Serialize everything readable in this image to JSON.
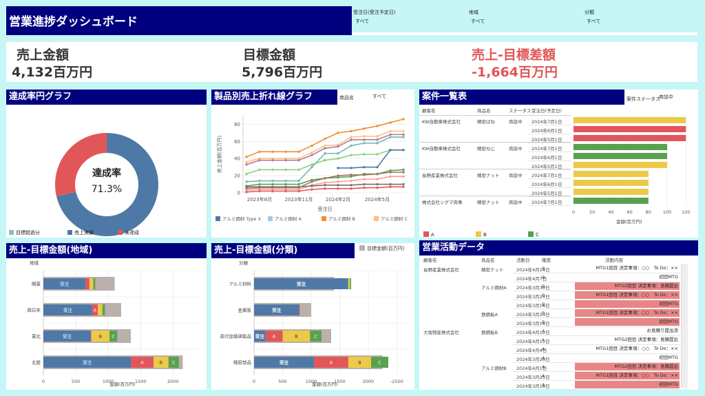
{
  "header": {
    "title": "営業進捗ダッシュボード",
    "filters": [
      {
        "label": "受注日(受注予定日)",
        "value": "すべて"
      },
      {
        "label": "地域",
        "value": "すべて"
      },
      {
        "label": "分類",
        "value": "すべて"
      }
    ]
  },
  "kpis": [
    {
      "label": "売上金額",
      "value": "4,132百万円",
      "color": "#333333"
    },
    {
      "label": "目標金額",
      "value": "5,796百万円",
      "color": "#333333"
    },
    {
      "label": "売上-目標差額",
      "value": "-1,664百万円",
      "color": "#e05555"
    }
  ],
  "donut": {
    "title": "達成率円グラフ",
    "center_label": "達成率",
    "center_value": "71.3%",
    "legend": [
      "目標超過分",
      "売上実績",
      "未達成"
    ],
    "colors": {
      "over": "#7fc4b8",
      "actual": "#4e79a7",
      "missing": "#e15759"
    }
  },
  "line_panel": {
    "title": "製品別売上折れ線グラフ",
    "filter_label": "商品名",
    "filter_value": "すべて"
  },
  "cases_panel": {
    "title": "案件一覧表",
    "filter_label": "案件ステータス",
    "filter_value": "商談中",
    "columns": [
      "顧客名",
      "商品名",
      "ステータス",
      "受注日(予定日)"
    ],
    "rows": [
      {
        "customer": "KW自動車株式会社",
        "product": "精密ばね",
        "status": "商談中",
        "date": "2024年7月1日"
      },
      {
        "customer": "",
        "product": "",
        "status": "",
        "date": "2024年6月1日"
      },
      {
        "customer": "",
        "product": "",
        "status": "",
        "date": "2024年5月1日"
      },
      {
        "customer": "KW自動車株式会社",
        "product": "精密ねじ",
        "status": "商談中",
        "date": "2024年7月1日"
      },
      {
        "customer": "",
        "product": "",
        "status": "",
        "date": "2024年6月1日"
      },
      {
        "customer": "",
        "product": "",
        "status": "",
        "date": "2024年5月1日"
      },
      {
        "customer": "長野産業株式会社",
        "product": "精密ナット",
        "status": "商談中",
        "date": "2024年7月1日"
      },
      {
        "customer": "",
        "product": "",
        "status": "",
        "date": "2024年6月1日"
      },
      {
        "customer": "",
        "product": "",
        "status": "",
        "date": "2024年5月1日"
      },
      {
        "customer": "株式会社シグマ商事",
        "product": "精密ナット",
        "status": "商談中",
        "date": "2024年7月1日"
      }
    ],
    "xlabel": "金額(百万円)",
    "legend": [
      "A",
      "B",
      "C"
    ]
  },
  "activity_panel": {
    "title": "営業活動データ",
    "columns": [
      "顧客名",
      "商品名",
      "活動日",
      "確度",
      "活動内容"
    ],
    "rows": [
      {
        "customer": "長野産業株式会社",
        "product": "精密ナット",
        "date": "2024年4月14日",
        "rank": "B",
        "content": "MTG1回目 決定事項：○○　To Do：××",
        "hl": false
      },
      {
        "customer": "",
        "product": "",
        "date": "2024年4月7日",
        "rank": "B",
        "content": "初回MTG",
        "hl": false
      },
      {
        "customer": "",
        "product": "アルミ鋼材A",
        "date": "2024年3月30日",
        "rank": "B",
        "content": "MTG2回目 決定事項：見積提出",
        "hl": true
      },
      {
        "customer": "",
        "product": "",
        "date": "2024年3月23日",
        "rank": "B",
        "content": "MTG1回目 決定事項：○○　To Do：××",
        "hl": true
      },
      {
        "customer": "",
        "product": "",
        "date": "2024年3月16日",
        "rank": "B",
        "content": "初回MTG",
        "hl": true
      },
      {
        "customer": "",
        "product": "鉄鋼板A",
        "date": "2024年3月23日",
        "rank": "B",
        "content": "MTG1回目 決定事項：○○　To Do：××",
        "hl": true
      },
      {
        "customer": "",
        "product": "",
        "date": "2024年3月16日",
        "rank": "B",
        "content": "初回MTG",
        "hl": true
      },
      {
        "customer": "大坂物産株式会社",
        "product": "鉄鋼板B",
        "date": "2024年4月12日",
        "rank": "A",
        "content": "お見積り提出済",
        "hl": false
      },
      {
        "customer": "",
        "product": "",
        "date": "2024年4月11日",
        "rank": "A",
        "content": "MTG2回目 決定事項：見積提出",
        "hl": false
      },
      {
        "customer": "",
        "product": "",
        "date": "2024年4月4日",
        "rank": "A",
        "content": "MTG1回目 決定事項：○○　To Do：××",
        "hl": false
      },
      {
        "customer": "",
        "product": "",
        "date": "2024年3月28日",
        "rank": "A",
        "content": "初回MTG",
        "hl": false
      },
      {
        "customer": "",
        "product": "アルミ鋼材B",
        "date": "2024年4月1日",
        "rank": "A",
        "content": "MTG2回目 決定事項：見積提出",
        "hl": true
      },
      {
        "customer": "",
        "product": "",
        "date": "2024年3月25日",
        "rank": "A",
        "content": "MTG1回目 決定事項：○○　To Do：××",
        "hl": true
      },
      {
        "customer": "",
        "product": "",
        "date": "2024年3月18日",
        "rank": "A",
        "content": "初回MTG",
        "hl": true
      }
    ]
  },
  "region_panel": {
    "title": "売上-目標金額(地域)",
    "axis_label": "地域",
    "xlabel": "金額(百万円)"
  },
  "category_panel": {
    "title": "売上-目標金額(分類)",
    "axis_label": "分類",
    "legend_label": "目標金額(百万円)",
    "xlabel": "金額(百万円)"
  },
  "chart_data": [
    {
      "type": "pie",
      "title": "達成率円グラフ",
      "categories": [
        "目標超過分",
        "売上実績",
        "未達成"
      ],
      "values": [
        0,
        71.3,
        28.7
      ]
    },
    {
      "type": "line",
      "title": "製品別売上折れ線グラフ",
      "xlabel": "受注日",
      "ylabel": "売上金額(百万円)",
      "ylim": [
        0,
        90
      ],
      "yticks": [
        0,
        20,
        40,
        60,
        80
      ],
      "xticks": [
        "2023年8月",
        "2023年11月",
        "2024年2月",
        "2024年5月"
      ],
      "x": [
        "2023年7月",
        "2023年8月",
        "2023年9月",
        "2023年10月",
        "2023年11月",
        "2023年12月",
        "2024年1月",
        "2024年2月",
        "2024年3月",
        "2024年4月",
        "2024年5月",
        "2024年6月",
        "2024年7月"
      ],
      "legend": [
        "アルミ鋼材 Type X",
        "アルミ鋼材 A",
        "アルミ鋼材 B",
        "アルミ鋼材 C"
      ],
      "series": [
        {
          "color": "#f28e2b",
          "values": [
            42,
            48,
            48,
            48,
            48,
            55,
            63,
            70,
            72,
            75,
            78,
            82,
            86
          ]
        },
        {
          "color": "#ffbe7d",
          "values": [
            36,
            40,
            40,
            40,
            40,
            47,
            55,
            56,
            65,
            66,
            66,
            72,
            72
          ]
        },
        {
          "color": "#b07aa1",
          "values": [
            33,
            38,
            38,
            38,
            38,
            44,
            52,
            54,
            62,
            62,
            62,
            68,
            68
          ]
        },
        {
          "color": "#8cd17d",
          "values": [
            22,
            27,
            27,
            27,
            27,
            33,
            38,
            40,
            44,
            45,
            45,
            50,
            50
          ]
        },
        {
          "color": "#76b7b2",
          "values": [
            13,
            14,
            14,
            14,
            14,
            30,
            46,
            46,
            55,
            58,
            58,
            65,
            65
          ]
        },
        {
          "color": "#4e79a7",
          "values": [
            null,
            null,
            null,
            null,
            null,
            null,
            null,
            29,
            29,
            30,
            30,
            50,
            50
          ]
        },
        {
          "color": "#59a14f",
          "values": [
            8,
            10,
            10,
            10,
            10,
            15,
            17,
            18,
            19,
            22,
            22,
            26,
            27
          ]
        },
        {
          "color": "#9c755f",
          "values": [
            5,
            6,
            6,
            6,
            6,
            13,
            17,
            20,
            21,
            21,
            22,
            24,
            24
          ]
        },
        {
          "color": "#ff9d9a",
          "values": [
            3,
            4,
            4,
            4,
            4,
            9,
            12,
            13,
            14,
            16,
            16,
            19,
            19
          ]
        },
        {
          "color": "#e15759",
          "values": [
            1,
            2,
            2,
            2,
            2,
            4,
            5,
            5,
            5,
            6,
            6,
            7,
            7
          ]
        },
        {
          "color": "#79706e",
          "values": [
            7,
            7,
            7,
            7,
            7,
            8,
            9,
            9,
            9,
            10,
            10,
            10,
            10
          ]
        }
      ]
    },
    {
      "type": "bar",
      "title": "案件一覧表",
      "xlim": [
        0,
        125
      ],
      "xticks": [
        0,
        20,
        40,
        60,
        80,
        100,
        120
      ],
      "categories": [
        "2024年7月1日",
        "2024年6月1日",
        "2024年5月1日",
        "2024年7月1日",
        "2024年6月1日",
        "2024年5月1日",
        "2024年7月1日",
        "2024年6月1日",
        "2024年5月1日",
        "2024年7月1日"
      ],
      "values": [
        120,
        120,
        120,
        100,
        100,
        100,
        80,
        80,
        80,
        80
      ],
      "rank": [
        "B",
        "A",
        "A",
        "C",
        "C",
        "B",
        "B",
        "B",
        "B",
        "C"
      ],
      "colors": {
        "A": "#e15759",
        "B": "#edc948",
        "C": "#59a14f"
      }
    },
    {
      "type": "bar",
      "title": "売上-目標金額(地域)",
      "categories": [
        "関東",
        "西日本",
        "東北",
        "北陸"
      ],
      "xlim": [
        0,
        2400
      ],
      "xticks": [
        0,
        500,
        1000,
        1500,
        2000
      ],
      "segments": [
        "受注",
        "A",
        "B",
        "C"
      ],
      "series": [
        {
          "name": "受注",
          "values": [
            650,
            750,
            730,
            1350
          ]
        },
        {
          "name": "A",
          "values": [
            60,
            90,
            10,
            350
          ]
        },
        {
          "name": "B",
          "values": [
            60,
            70,
            280,
            230
          ]
        },
        {
          "name": "C",
          "values": [
            30,
            40,
            120,
            160
          ]
        }
      ],
      "target": [
        1100,
        1200,
        1350,
        2150
      ]
    },
    {
      "type": "bar",
      "title": "売上-目標金額(分類)",
      "categories": [
        "アルミ材料",
        "金属板",
        "高付加価値製品",
        "精密部品"
      ],
      "xlim": [
        0,
        2700
      ],
      "xticks": [
        0,
        500,
        1000,
        1500,
        2000
      ],
      "xtick_end": "2500",
      "segments": [
        "受注",
        "A",
        "B",
        "C"
      ],
      "series": [
        {
          "name": "受注",
          "values": [
            1650,
            790,
            200,
            1050
          ]
        },
        {
          "name": "A",
          "values": [
            0,
            10,
            300,
            600
          ]
        },
        {
          "name": "B",
          "values": [
            30,
            0,
            480,
            400
          ]
        },
        {
          "name": "C",
          "values": [
            20,
            0,
            200,
            300
          ]
        }
      ],
      "target": [
        1400,
        1000,
        1350,
        2250
      ]
    }
  ]
}
